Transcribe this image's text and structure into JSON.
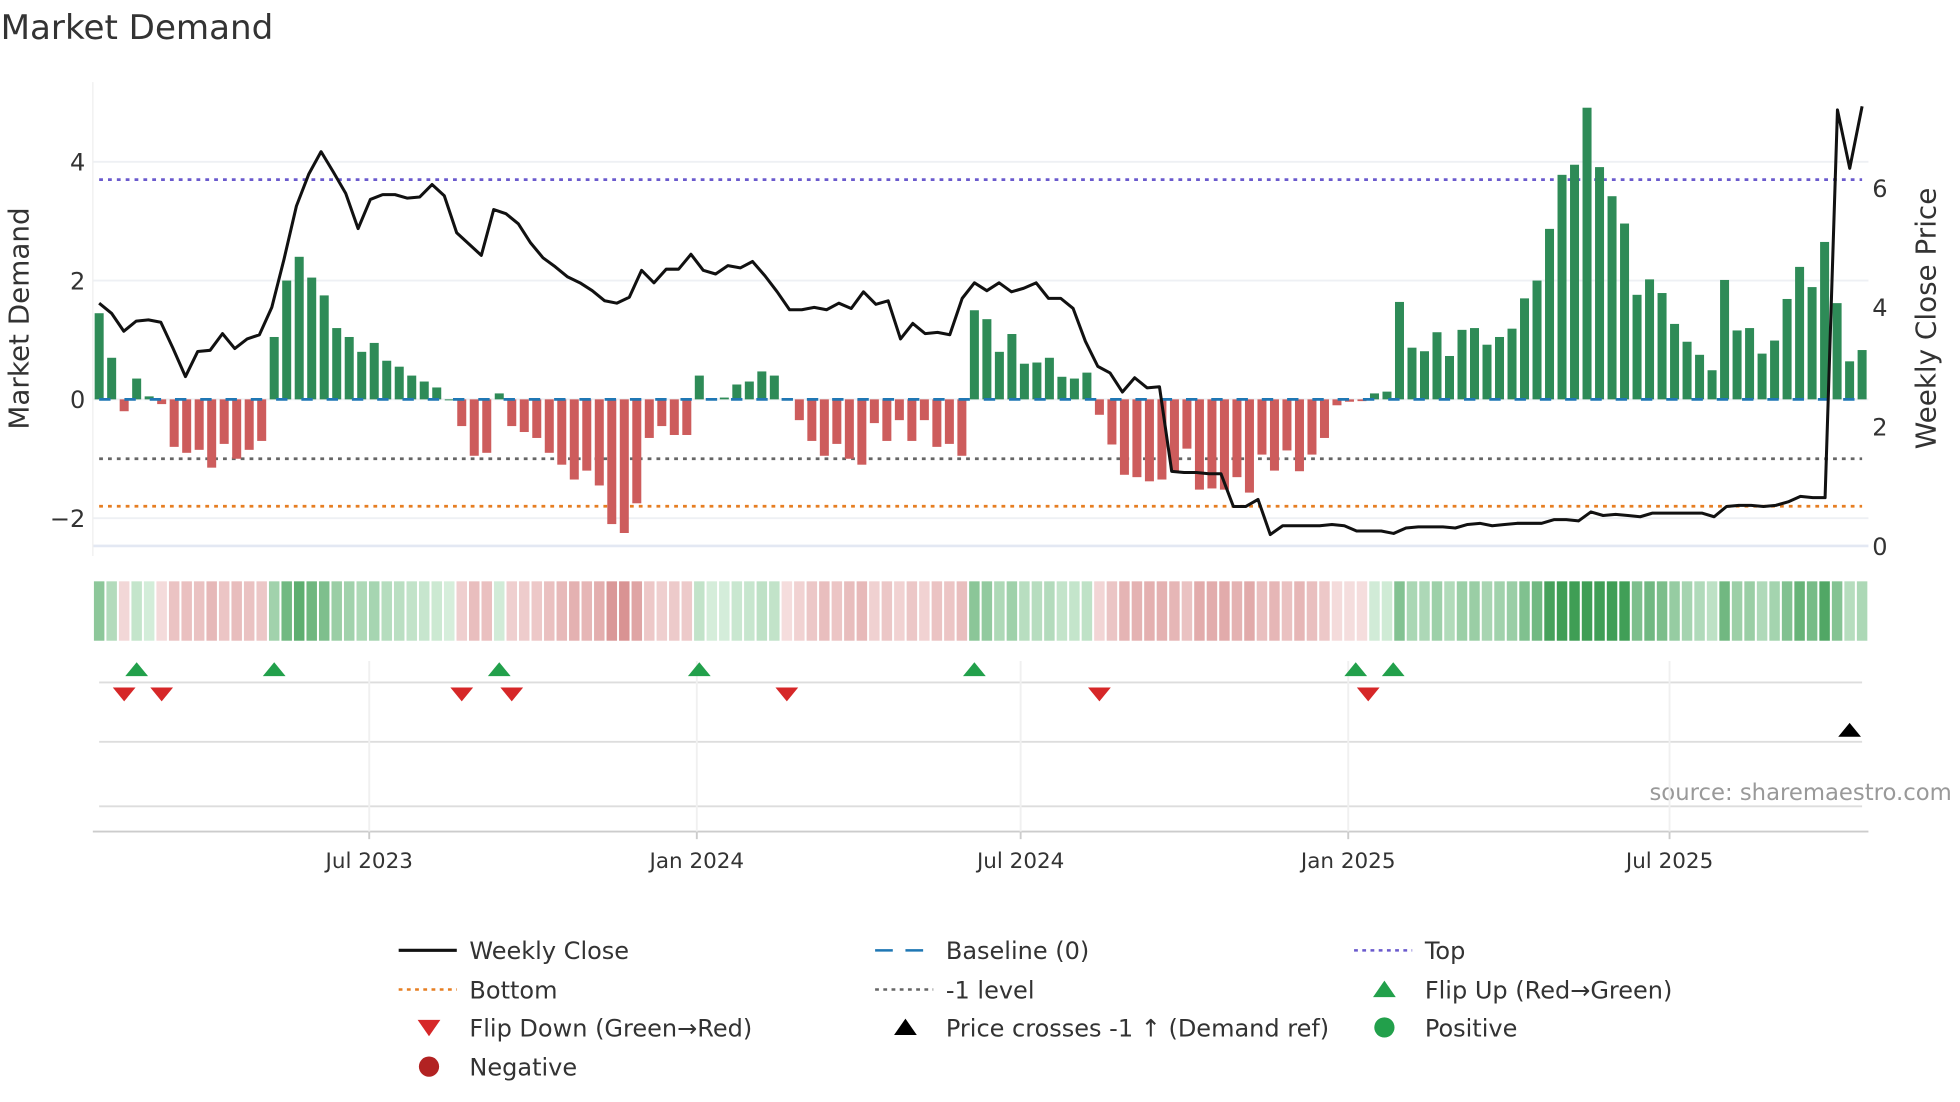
{
  "chart_data": {
    "type": "bar",
    "title": "Market Demand",
    "ylabel": "Market Demand",
    "y2label": "Weekly Close Price",
    "ylim": [
      -2.5,
      5.0
    ],
    "y2lim": [
      0,
      7.5
    ],
    "yticks": [
      {
        "v": -2,
        "label": "−2"
      },
      {
        "v": 0,
        "label": "0"
      },
      {
        "v": 2,
        "label": "2"
      },
      {
        "v": 4,
        "label": "4"
      }
    ],
    "y2ticks": [
      {
        "v": 0,
        "label": "0"
      },
      {
        "v": 2,
        "label": "2"
      },
      {
        "v": 4,
        "label": "4"
      },
      {
        "v": 6,
        "label": "6"
      }
    ],
    "xticks": [
      {
        "week": 21.6,
        "label": "Jul 2023"
      },
      {
        "week": 47.8,
        "label": "Jan 2024"
      },
      {
        "week": 73.7,
        "label": "Jul 2024"
      },
      {
        "week": 99.9,
        "label": "Jan 2025"
      },
      {
        "week": 125.6,
        "label": "Jul 2025"
      }
    ],
    "levels": {
      "top": 3.7,
      "bottom": -1.8,
      "minus_one": -1.0,
      "baseline": 0
    },
    "demand": [
      1.45,
      0.7,
      -0.2,
      0.35,
      0.05,
      -0.08,
      -0.8,
      -0.9,
      -0.85,
      -1.15,
      -0.75,
      -1.0,
      -0.85,
      -0.7,
      1.05,
      2.0,
      2.4,
      2.05,
      1.75,
      1.2,
      1.05,
      0.8,
      0.95,
      0.65,
      0.55,
      0.4,
      0.3,
      0.2,
      0.0,
      -0.45,
      -0.95,
      -0.9,
      0.1,
      -0.45,
      -0.55,
      -0.65,
      -0.9,
      -1.1,
      -1.35,
      -1.2,
      -1.45,
      -2.1,
      -2.25,
      -1.75,
      -0.65,
      -0.45,
      -0.6,
      -0.6,
      0.4,
      0.02,
      0.03,
      0.25,
      0.3,
      0.47,
      0.4,
      -0.02,
      -0.35,
      -0.7,
      -0.95,
      -0.75,
      -1.0,
      -1.1,
      -0.4,
      -0.7,
      -0.35,
      -0.7,
      -0.35,
      -0.8,
      -0.75,
      -0.95,
      1.5,
      1.35,
      0.8,
      1.1,
      0.6,
      0.62,
      0.7,
      0.38,
      0.35,
      0.45,
      -0.26,
      -0.76,
      -1.27,
      -1.31,
      -1.38,
      -1.35,
      -1.2,
      -0.83,
      -1.52,
      -1.5,
      -1.52,
      -1.31,
      -1.57,
      -0.93,
      -1.2,
      -0.86,
      -1.21,
      -0.93,
      -0.65,
      -0.1,
      -0.04,
      -0.03,
      0.1,
      0.13,
      1.64,
      0.87,
      0.81,
      1.13,
      0.73,
      1.17,
      1.2,
      0.92,
      1.05,
      1.19,
      1.7,
      2.0,
      2.87,
      3.78,
      3.95,
      4.91,
      3.91,
      3.42,
      2.96,
      1.76,
      2.02,
      1.79,
      1.27,
      0.97,
      0.75,
      0.49,
      2.01,
      1.16,
      1.2,
      0.77,
      0.99,
      1.69,
      2.23,
      1.89,
      2.65,
      1.62,
      0.64,
      0.83
    ],
    "price": [
      4.07,
      3.9,
      3.6,
      3.77,
      3.79,
      3.75,
      3.31,
      2.84,
      3.26,
      3.28,
      3.56,
      3.31,
      3.47,
      3.54,
      4.0,
      4.81,
      5.7,
      6.23,
      6.61,
      6.27,
      5.91,
      5.32,
      5.81,
      5.89,
      5.89,
      5.83,
      5.85,
      6.06,
      5.87,
      5.25,
      5.06,
      4.87,
      5.64,
      5.57,
      5.4,
      5.08,
      4.83,
      4.68,
      4.51,
      4.41,
      4.28,
      4.11,
      4.07,
      4.17,
      4.62,
      4.41,
      4.64,
      4.64,
      4.89,
      4.62,
      4.56,
      4.7,
      4.66,
      4.77,
      4.53,
      4.26,
      3.96,
      3.96,
      4.0,
      3.96,
      4.07,
      3.98,
      4.26,
      4.05,
      4.11,
      3.47,
      3.73,
      3.56,
      3.58,
      3.54,
      4.15,
      4.41,
      4.28,
      4.41,
      4.26,
      4.32,
      4.41,
      4.15,
      4.15,
      3.98,
      3.43,
      3.01,
      2.9,
      2.58,
      2.82,
      2.65,
      2.67,
      1.25,
      1.23,
      1.23,
      1.21,
      1.21,
      0.66,
      0.66,
      0.78,
      0.19,
      0.34,
      0.34,
      0.34,
      0.34,
      0.36,
      0.34,
      0.25,
      0.25,
      0.25,
      0.21,
      0.3,
      0.32,
      0.32,
      0.32,
      0.3,
      0.36,
      0.38,
      0.34,
      0.36,
      0.38,
      0.38,
      0.38,
      0.44,
      0.44,
      0.42,
      0.57,
      0.51,
      0.53,
      0.51,
      0.49,
      0.55,
      0.55,
      0.55,
      0.55,
      0.55,
      0.49,
      0.66,
      0.68,
      0.68,
      0.66,
      0.68,
      0.74,
      0.83,
      0.81,
      0.81,
      7.31,
      6.33,
      7.37
    ],
    "flip_up_weeks": [
      3,
      14,
      32,
      48,
      70,
      100.5,
      103.5
    ],
    "flip_down_weeks": [
      2,
      5,
      29,
      33,
      55,
      80,
      101.5
    ],
    "price_cross_weeks": [
      140
    ],
    "legend": [
      {
        "label": "Weekly Close",
        "kind": "line",
        "color": "#111111"
      },
      {
        "label": "Baseline (0)",
        "kind": "dash",
        "color": "#1f77b4"
      },
      {
        "label": "Top",
        "kind": "dot",
        "color": "#6a5acd"
      },
      {
        "label": "Bottom",
        "kind": "dot",
        "color": "#e67e22"
      },
      {
        "label": "-1 level",
        "kind": "dot",
        "color": "#666666"
      },
      {
        "label": "Flip Up (Red→Green)",
        "kind": "tri-up",
        "color": "#22a04b"
      },
      {
        "label": "Flip Down (Green→Red)",
        "kind": "tri-down",
        "color": "#d62728"
      },
      {
        "label": "Price crosses -1 ↑ (Demand ref)",
        "kind": "tri-up",
        "color": "#000000"
      },
      {
        "label": "Positive",
        "kind": "dot-marker",
        "color": "#22a04b"
      },
      {
        "label": "Negative",
        "kind": "dot-marker",
        "color": "#b22222"
      }
    ],
    "legend_placement": "bottom",
    "colors": {
      "positive": "#2e8b57",
      "negative": "#cd5c5c",
      "baseline": "#1f77b4"
    }
  },
  "source": "source: sharemaestro.com"
}
